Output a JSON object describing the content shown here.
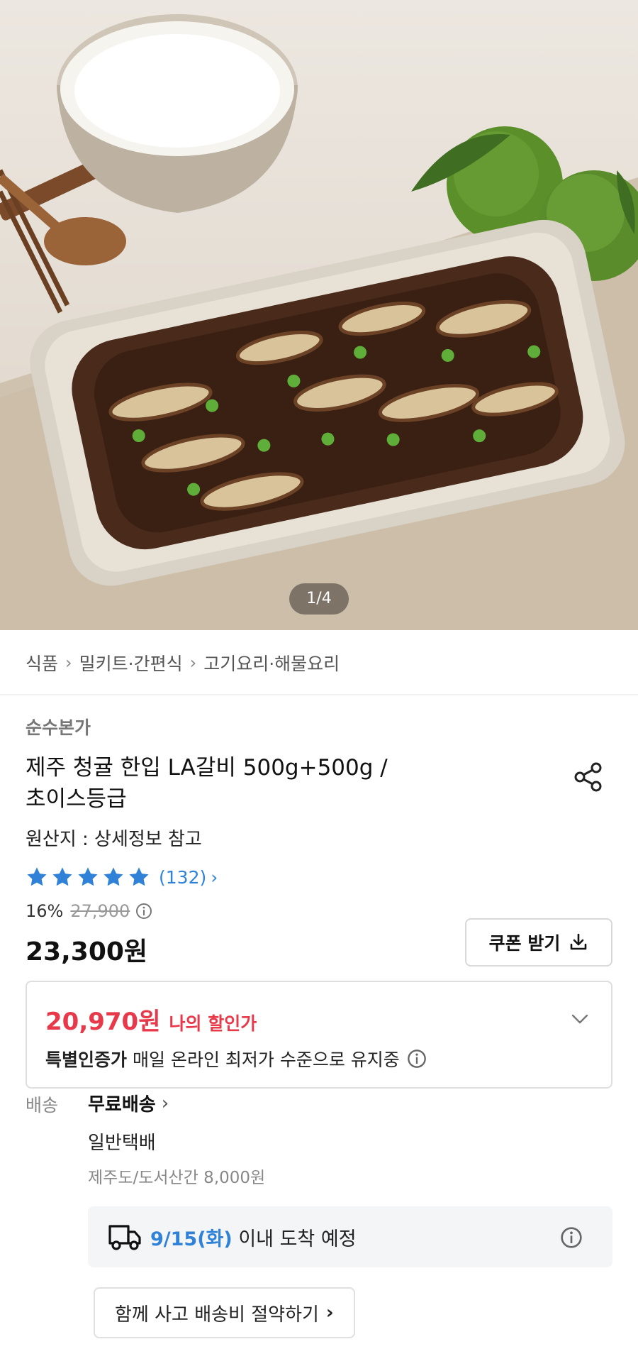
{
  "hero": {
    "pager": "1/4"
  },
  "breadcrumb": [
    "식품",
    "밀키트·간편식",
    "고기요리·해물요리"
  ],
  "product": {
    "brand": "순수본가",
    "title_line1": "제주 청귤 한입 LA갈비 500g+500g /",
    "title_line2": "초이스등급",
    "origin": "원산지 : 상세정보 참고",
    "rating_count": "(132)",
    "rating_stars": 5,
    "discount_pct": "16%",
    "original_price": "27,900",
    "price": "23,300원"
  },
  "coupon": {
    "label": "쿠폰 받기"
  },
  "my_price": {
    "value": "20,970원",
    "label": "나의 할인가",
    "cert_bold": "특별인증가",
    "cert_text": "매일 온라인 최저가 수준으로 유지중"
  },
  "shipping": {
    "label": "배송",
    "free": "무료배송",
    "type": "일반택배",
    "extra": "제주도/도서산간 8,000원",
    "eta_date": "9/15(화)",
    "eta_text": " 이내 도착 예정"
  },
  "bundle": {
    "label": "함께 사고 배송비 절약하기"
  },
  "colors": {
    "accent_blue": "#2f82d8",
    "price_red": "#e8394a",
    "star": "#2f82d8"
  }
}
